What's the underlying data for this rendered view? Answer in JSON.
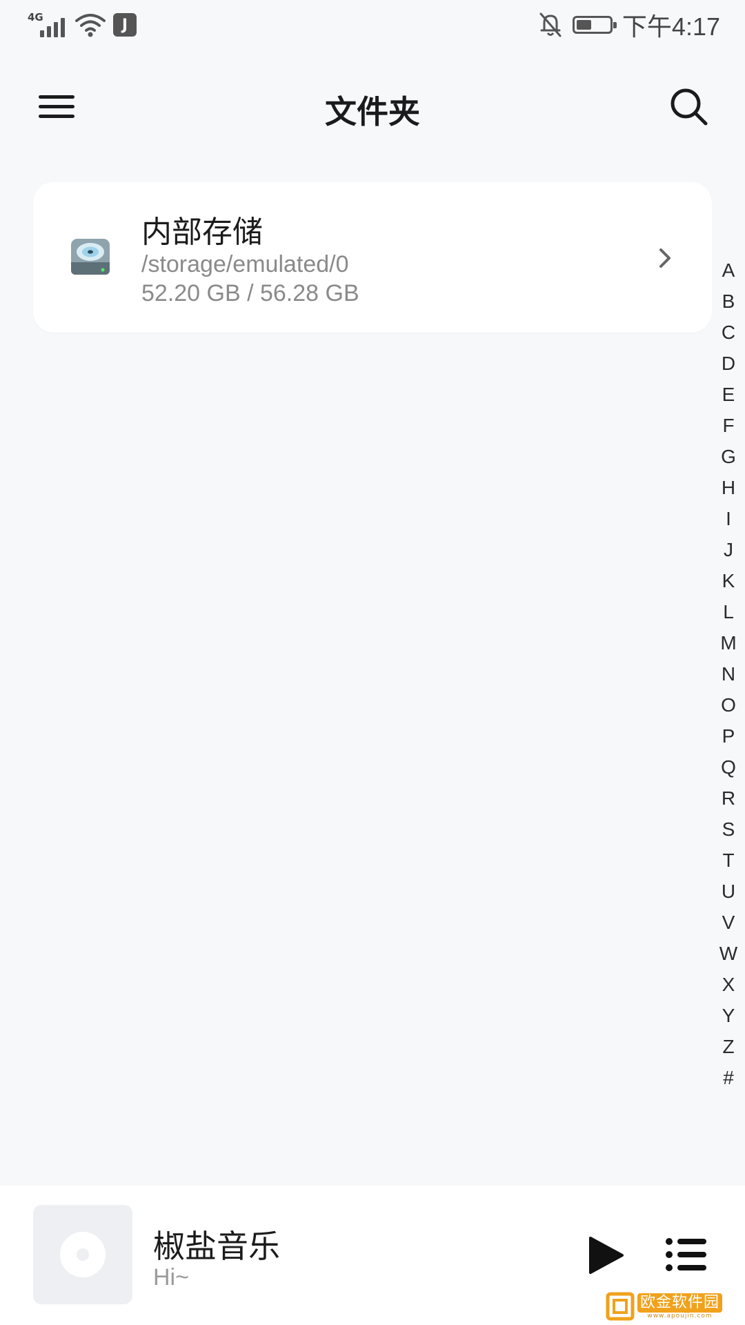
{
  "status_bar": {
    "network": "4G",
    "app_badge": "J",
    "time": "下午4:17",
    "battery_level": 0.45
  },
  "top_bar": {
    "title": "文件夹",
    "menu_icon": "hamburger-menu-icon",
    "search_icon": "search-icon"
  },
  "storage": {
    "name": "内部存储",
    "path": "/storage/emulated/0",
    "size": "52.20 GB / 56.28 GB",
    "icon": "hard-drive-icon"
  },
  "alphabet_index": [
    "A",
    "B",
    "C",
    "D",
    "E",
    "F",
    "G",
    "H",
    "I",
    "J",
    "K",
    "L",
    "M",
    "N",
    "O",
    "P",
    "Q",
    "R",
    "S",
    "T",
    "U",
    "V",
    "W",
    "X",
    "Y",
    "Z",
    "#"
  ],
  "player": {
    "title": "椒盐音乐",
    "subtitle": "Hi~",
    "play_icon": "play-icon",
    "playlist_icon": "playlist-icon"
  },
  "watermark": {
    "text": "欧金软件园",
    "url": "www.apoujin.com"
  },
  "colors": {
    "background": "#f7f8fa",
    "card": "#ffffff",
    "primary_text": "#1b1b1b",
    "secondary_text": "#8a8a8a",
    "watermark": "#f0a21c"
  }
}
